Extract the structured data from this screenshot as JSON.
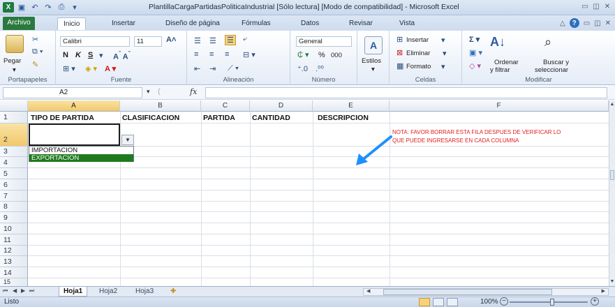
{
  "window": {
    "title": "PlantillaCargaPartidasPoliticaIndustrial  [Sólo lectura]  [Modo de compatibilidad]  -  Microsoft Excel",
    "app_icon": "excel-icon"
  },
  "ribbon_tabs": [
    "Archivo",
    "Inicio",
    "Insertar",
    "Diseño de página",
    "Fórmulas",
    "Datos",
    "Revisar",
    "Vista"
  ],
  "ribbon": {
    "clipboard": {
      "label": "Portapapeles",
      "paste": "Pegar"
    },
    "font": {
      "label": "Fuente",
      "name": "Calibri",
      "size": "11",
      "bold": "N",
      "italic": "K",
      "underline": "S"
    },
    "alignment": {
      "label": "Alineación"
    },
    "number": {
      "label": "Número",
      "format": "General",
      "percent": "%",
      "thousands": "000"
    },
    "styles": {
      "label": "Estilos"
    },
    "cells": {
      "label": "Celdas",
      "insert": "Insertar",
      "delete": "Eliminar",
      "format": "Formato"
    },
    "modify": {
      "label": "Modificar",
      "sort": "Ordenar\ny filtrar",
      "sort_line1": "Ordenar",
      "sort_line2": "y filtrar",
      "find_line1": "Buscar y",
      "find_line2": "seleccionar"
    }
  },
  "formula_bar": {
    "name_box": "A2",
    "fx": "fx",
    "value": ""
  },
  "columns": [
    "A",
    "B",
    "C",
    "D",
    "E",
    "F"
  ],
  "rows": [
    "1",
    "2",
    "3",
    "4",
    "5",
    "6",
    "7",
    "8",
    "9",
    "10",
    "11",
    "12",
    "13",
    "14",
    "15"
  ],
  "header_row": {
    "A1": "TIPO DE PARTIDA",
    "B1": "CLASIFICACION",
    "C1": "PARTIDA",
    "D1": "CANTIDAD",
    "E1": "DESCRIPCION"
  },
  "note_text_line1": "NOTA: FAVOR BORRAR ESTA FILA DESPUES DE VERIFICAR LO",
  "note_text_line2": "QUE PUEDE INGRESARSE EN CADA COLUMNA",
  "dropdown": {
    "options": [
      "IMPORTACION",
      "EXPORTACION"
    ],
    "highlighted": "EXPORTACION"
  },
  "sheets": [
    "Hoja1",
    "Hoja2",
    "Hoja3"
  ],
  "active_sheet": "Hoja1",
  "status": {
    "text": "Listo",
    "zoom": "100%"
  },
  "colors": {
    "accent": "#1f7a3e",
    "note": "#e02020",
    "arrow": "#1e90ff",
    "selection_header": "#f2c86a"
  }
}
